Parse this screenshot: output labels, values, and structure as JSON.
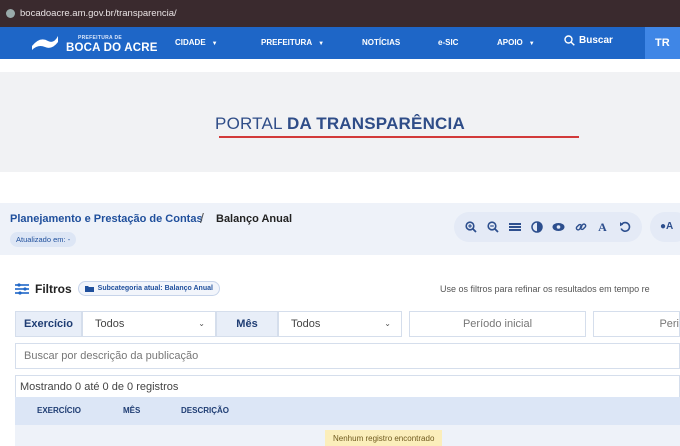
{
  "browser": {
    "url": "bocadoacre.am.gov.br/transparencia/"
  },
  "header": {
    "logo_small": "PREFEITURA DE",
    "logo_big": "BOCA DO ACRE",
    "nav": [
      {
        "label": "CIDADE",
        "has_dropdown": true
      },
      {
        "label": "PREFEITURA",
        "has_dropdown": true
      },
      {
        "label": "NOTÍCIAS",
        "has_dropdown": false
      },
      {
        "label": "e-SIC",
        "has_dropdown": false
      },
      {
        "label": "APOIO",
        "has_dropdown": true
      }
    ],
    "search_label": "Buscar",
    "cut_button": "TR",
    "colors": {
      "nav_bg": "#1e66c7",
      "accent_line": "#d23a3a"
    }
  },
  "portal": {
    "title_light": "PORTAL ",
    "title_bold": "DA TRANSPARÊNCIA"
  },
  "breadcrumb": {
    "parent": "Planejamento e Prestação de Contas",
    "separator": "/",
    "current": "Balanço Anual",
    "updated_label": "Atualizado em: -"
  },
  "accessibility": {
    "buttons": [
      "zoom-in-icon",
      "zoom-out-icon",
      "contrast-bars-icon",
      "contrast-icon",
      "eye-icon",
      "link-icon",
      "font-icon",
      "reset-icon"
    ],
    "font_label": "A",
    "extra_cut": "A"
  },
  "filters": {
    "label": "Filtros",
    "subcategory": "Subcategoria atual: Balanço Anual",
    "hint": "Use os filtros para refinar os resultados em tempo re",
    "exercicio_label": "Exercício",
    "exercicio_value": "Todos",
    "mes_label": "Mês",
    "mes_value": "Todos",
    "periodo_inicial": "Período inicial",
    "periodo_final_cut": "Peri",
    "search_placeholder": "Buscar por descrição da publicação"
  },
  "table": {
    "records_text": "Mostrando 0 até 0 de 0 registros",
    "columns": [
      "EXERCÍCIO",
      "MÊS",
      "DESCRIÇÃO"
    ],
    "empty_message": "Nenhum registro encontrado"
  }
}
